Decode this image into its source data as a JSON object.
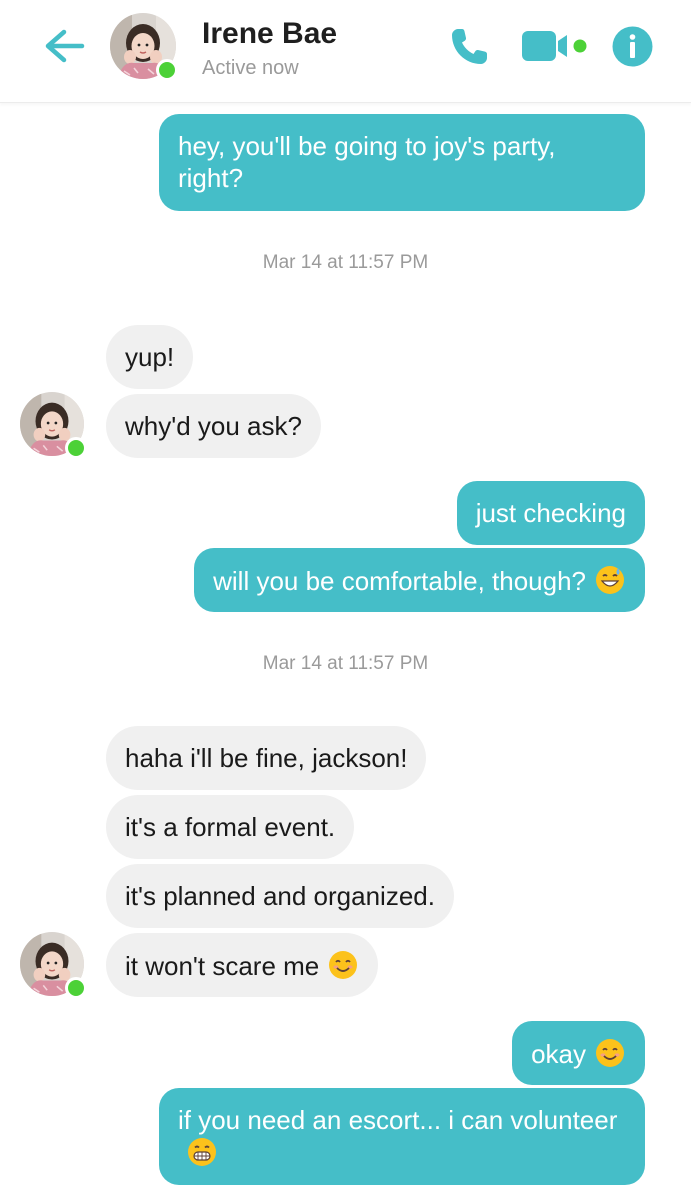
{
  "header": {
    "contact_name": "Irene Bae",
    "status": "Active now",
    "back_icon": "back-arrow-icon",
    "call_icon": "phone-icon",
    "video_icon": "video-camera-icon",
    "info_icon": "info-icon"
  },
  "colors": {
    "accent": "#45bec8",
    "incoming_bubble": "#f0f0f0",
    "presence": "#4cd137",
    "timestamp_text": "#9a9a9a"
  },
  "messages": {
    "m1": {
      "text": "hey, you'll be going to joy's party, right?"
    },
    "ts1": "Mar 14 at 11:57 PM",
    "m2": {
      "text": "yup!"
    },
    "m3": {
      "text": "why'd you ask?"
    },
    "m4": {
      "text": "just checking"
    },
    "m5": {
      "text": "will you be comfortable, though?",
      "emoji": "grinning-sweat-emoji"
    },
    "ts2": "Mar 14 at 11:57 PM",
    "m6": {
      "text": "haha i'll be fine, jackson!"
    },
    "m7": {
      "text": "it's a formal event."
    },
    "m8": {
      "text": "it's planned and organized."
    },
    "m9": {
      "text": "it won't scare me",
      "emoji": "smiling-emoji"
    },
    "m10": {
      "text": "okay",
      "emoji": "smiling-emoji"
    },
    "m11": {
      "text": "if you need an escort... i can volunteer",
      "emoji": "grinning-teeth-emoji"
    }
  }
}
